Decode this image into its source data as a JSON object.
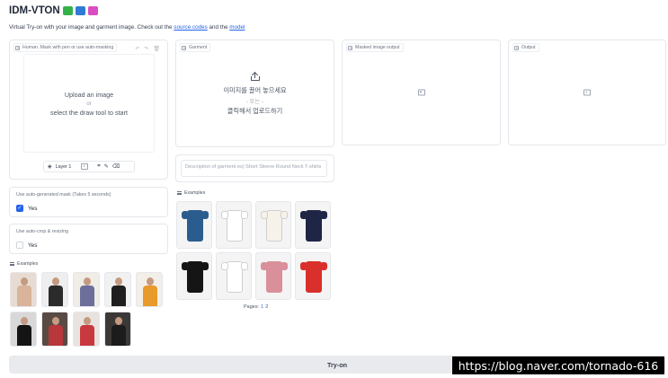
{
  "app": {
    "title": "IDM-VTON",
    "emoji_colors": [
      "#33b249",
      "#2f7bd6",
      "#d94dc0"
    ]
  },
  "subtitle": {
    "prefix": "Virtual Try-on with your image and garment image. Check out the ",
    "link1": "source codes",
    "middle": " and the ",
    "link2": "model"
  },
  "human_panel": {
    "label": "Human. Mask with pen or use auto-masking",
    "upload_main": "Upload an image",
    "upload_or": "or",
    "upload_secondary": "select the draw tool to start",
    "layer_label": "Layer 1"
  },
  "garment_panel": {
    "label": "Garment",
    "upload_main": "이미지를 끌어 놓으세요",
    "upload_or": "- 또는 -",
    "upload_secondary": "클릭해서 업로드하기"
  },
  "masked_panel": {
    "label": "Masked image output"
  },
  "output_panel": {
    "label": "Output"
  },
  "description": {
    "placeholder": "Description of garment ex) Short Sleeve Round Neck T-shirts"
  },
  "auto_mask": {
    "label": "Use auto-generated mask (Takes 5 seconds)",
    "option": "Yes",
    "checked": true
  },
  "auto_crop": {
    "label": "Use auto-crop & resizing",
    "option": "Yes",
    "checked": false
  },
  "human_examples": {
    "label": "Examples",
    "items": [
      {
        "name": "woman-beige-top",
        "bg": "#e8dcd2",
        "fg": "#d9b39a"
      },
      {
        "name": "woman-black-top",
        "bg": "#eeeeee",
        "fg": "#2b2b2b"
      },
      {
        "name": "woman-tshirt-print",
        "bg": "#f0ece6",
        "fg": "#6d6f9a"
      },
      {
        "name": "man-black-tshirt",
        "bg": "#f1f1f1",
        "fg": "#1f1f1f"
      },
      {
        "name": "woman-orange-top",
        "bg": "#f3efe8",
        "fg": "#e89a2a"
      },
      {
        "name": "man-leather-jacket",
        "bg": "#d8d8d8",
        "fg": "#141414"
      },
      {
        "name": "man-red-shirt",
        "bg": "#5a4a44",
        "fg": "#b8373a"
      },
      {
        "name": "woman-red-dress",
        "bg": "#e9e3df",
        "fg": "#c8393f"
      },
      {
        "name": "man-dark-suit",
        "bg": "#3b3838",
        "fg": "#1c1c1c"
      }
    ]
  },
  "garment_examples": {
    "label": "Examples",
    "items": [
      {
        "name": "blue-wrap-top",
        "bg": "#f4f4f4",
        "fg": "#2a5d8e"
      },
      {
        "name": "minnie-tshirt",
        "bg": "#f4f4f4",
        "fg": "#ffffff"
      },
      {
        "name": "white-tank-top",
        "bg": "#f4f4f4",
        "fg": "#f6f2ea"
      },
      {
        "name": "colorblock-top",
        "bg": "#f4f4f4",
        "fg": "#1f2545"
      },
      {
        "name": "black-graphic-tee",
        "bg": "#f4f4f4",
        "fg": "#151515"
      },
      {
        "name": "white-print-tee",
        "bg": "#f4f4f4",
        "fg": "#ffffff"
      },
      {
        "name": "pink-polo-dress",
        "bg": "#f4f4f4",
        "fg": "#d9909a"
      },
      {
        "name": "red-tie-blouse",
        "bg": "#f4f4f4",
        "fg": "#d9302b"
      }
    ],
    "pages_label": "Pages:",
    "page1": "1",
    "page2": "2"
  },
  "tryon_button": {
    "label": "Try-on"
  },
  "watermark": {
    "text": "https://blog.naver.com/tornado-616"
  }
}
